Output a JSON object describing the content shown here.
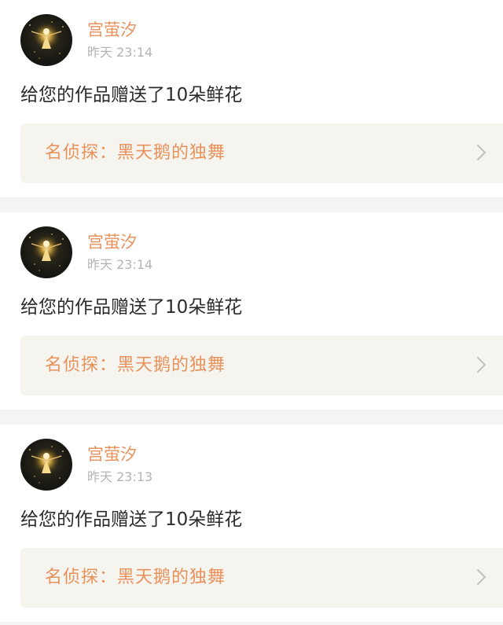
{
  "colors": {
    "accent": "#e8915a",
    "text": "#2b2b2b",
    "muted": "#b4b4b4",
    "link_bg": "#f5f4ef"
  },
  "notifications": [
    {
      "user": "宫萤汐",
      "time": "昨天 23:14",
      "message": "给您的作品赠送了10朵鲜花",
      "work_title": "名侦探：黑天鹅的独舞",
      "avatar_icon": "glowing-figure-avatar",
      "chevron_icon": "chevron-right-icon"
    },
    {
      "user": "宫萤汐",
      "time": "昨天 23:14",
      "message": "给您的作品赠送了10朵鲜花",
      "work_title": "名侦探：黑天鹅的独舞",
      "avatar_icon": "glowing-figure-avatar",
      "chevron_icon": "chevron-right-icon"
    },
    {
      "user": "宫萤汐",
      "time": "昨天 23:13",
      "message": "给您的作品赠送了10朵鲜花",
      "work_title": "名侦探：黑天鹅的独舞",
      "avatar_icon": "glowing-figure-avatar",
      "chevron_icon": "chevron-right-icon"
    }
  ]
}
